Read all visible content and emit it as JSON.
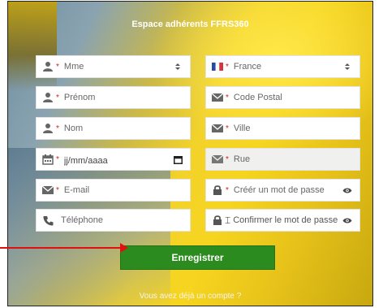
{
  "header": {
    "title": "Espace adhérents FFRS360"
  },
  "form": {
    "left": [
      {
        "name": "civility-select",
        "icon": "user-icon",
        "value": "Mme",
        "required": "*"
      },
      {
        "name": "firstname-input",
        "icon": "user-icon",
        "placeholder": "Prénom",
        "required": "*"
      },
      {
        "name": "lastname-input",
        "icon": "user-icon",
        "placeholder": "Nom",
        "required": "*"
      },
      {
        "name": "birthdate-input",
        "icon": "calendar-icon",
        "placeholder": "jj/mm/aaaa",
        "required": "*"
      },
      {
        "name": "email-input",
        "icon": "envelope-icon",
        "placeholder": "E-mail",
        "required": "*"
      },
      {
        "name": "phone-input",
        "icon": "phone-icon",
        "placeholder": "Téléphone",
        "required": ""
      }
    ],
    "right": [
      {
        "name": "country-select",
        "icon": "flag-france-icon",
        "value": "France",
        "required": "*"
      },
      {
        "name": "postal-code-input",
        "icon": "envelope-icon",
        "placeholder": "Code Postal",
        "required": "*"
      },
      {
        "name": "city-input",
        "icon": "envelope-icon",
        "placeholder": "Ville",
        "required": "*"
      },
      {
        "name": "street-input",
        "icon": "envelope-icon",
        "placeholder": "Rue",
        "required": "*"
      },
      {
        "name": "password-input",
        "icon": "lock-icon",
        "placeholder": "Créér un mot de passe",
        "required": "*"
      },
      {
        "name": "password-confirm-input",
        "icon": "lock-icon",
        "placeholder": "Confirmer le mot de passe",
        "required": ""
      }
    ]
  },
  "submit": {
    "label": "Enregistrer"
  },
  "footer": {
    "login_link": "Vous avez déjà un compte ?"
  },
  "colors": {
    "button": "#2c8b1e",
    "required": "#d21e1e",
    "arrow": "#e01010"
  }
}
